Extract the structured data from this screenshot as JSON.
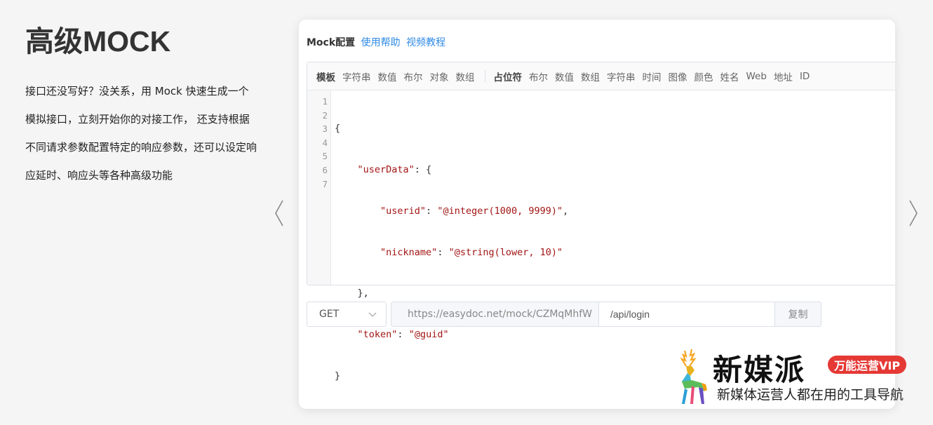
{
  "section": {
    "title": "高级MOCK",
    "description": "接口还没写好？没关系，用 Mock 快速生成一个模拟接口，立刻开始你的对接工作， 还支持根据不同请求参数配置特定的响应参数，还可以设定响应延时、响应头等各种高级功能"
  },
  "carousel": {
    "prev_icon": "chevron-left-icon",
    "next_icon": "chevron-right-icon"
  },
  "card": {
    "title": "Mock配置",
    "help_link": "使用帮助",
    "video_link": "视频教程"
  },
  "toolbar": {
    "group1": [
      "模板",
      "字符串",
      "数值",
      "布尔",
      "对象",
      "数组"
    ],
    "group2": [
      "占位符",
      "布尔",
      "数值",
      "数组",
      "字符串",
      "时间",
      "图像",
      "颜色",
      "姓名",
      "Web",
      "地址",
      "ID"
    ]
  },
  "code": {
    "line_numbers": [
      "1",
      "2",
      "3",
      "4",
      "5",
      "6",
      "7"
    ],
    "l1": "{",
    "l2_key": "\"userData\"",
    "l2_rest": ": {",
    "l3_key": "\"userid\"",
    "l3_val": "\"@integer(1000, 9999)\"",
    "l4_key": "\"nickname\"",
    "l4_val": "\"@string(lower, 10)\"",
    "l5": "},",
    "l6_key": "\"token\"",
    "l6_val": "\"@guid\"",
    "l7": "}"
  },
  "request": {
    "method": "GET",
    "url_prefix": "https://easydoc.net/mock/CZMqMhfW",
    "path": "/api/login",
    "copy_label": "复制"
  },
  "watermark": {
    "name": "新媒派",
    "badge": "万能运营VIP",
    "slogan": "新媒体运营人都在用的工具导航"
  },
  "colors": {
    "link": "#2f8ae5",
    "code_string": "#a31515",
    "badge": "#e53935"
  }
}
